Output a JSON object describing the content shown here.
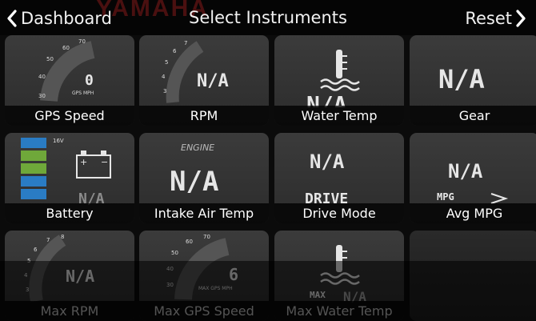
{
  "header": {
    "brand": "YAMAHA",
    "back_label": "Dashboard",
    "title": "Select Instruments",
    "reset_label": "Reset"
  },
  "tiles": [
    {
      "label": "GPS Speed",
      "gauge_ticks": [
        "30",
        "40",
        "50",
        "60",
        "70"
      ],
      "value": "0",
      "unit": "GPS MPH"
    },
    {
      "label": "RPM",
      "gauge_ticks": [
        "3",
        "4",
        "5",
        "6",
        "7"
      ],
      "value": "N/A"
    },
    {
      "label": "Water Temp",
      "value": "N/A"
    },
    {
      "label": "Gear",
      "value": "N/A"
    },
    {
      "label": "Battery",
      "scale_label": "16V",
      "value": "N/A",
      "colors": {
        "green": "#6fa83a",
        "blue": "#2a7cc4"
      }
    },
    {
      "label": "Intake Air Temp",
      "caption": "ENGINE",
      "value": "N/A"
    },
    {
      "label": "Drive Mode",
      "value": "N/A",
      "caption": "DRIVE"
    },
    {
      "label": "Avg MPG",
      "value": "N/A",
      "caption": "MPG"
    },
    {
      "label": "Max RPM",
      "gauge_ticks": [
        "3",
        "4",
        "5",
        "6",
        "7",
        "8"
      ],
      "value": "N/A"
    },
    {
      "label": "Max GPS Speed",
      "gauge_ticks": [
        "30",
        "40",
        "50",
        "60",
        "70"
      ],
      "value": "6",
      "unit": "MAX GPS MPH"
    },
    {
      "label": "Max Water Temp",
      "caption": "MAX",
      "value": "N/A"
    }
  ]
}
